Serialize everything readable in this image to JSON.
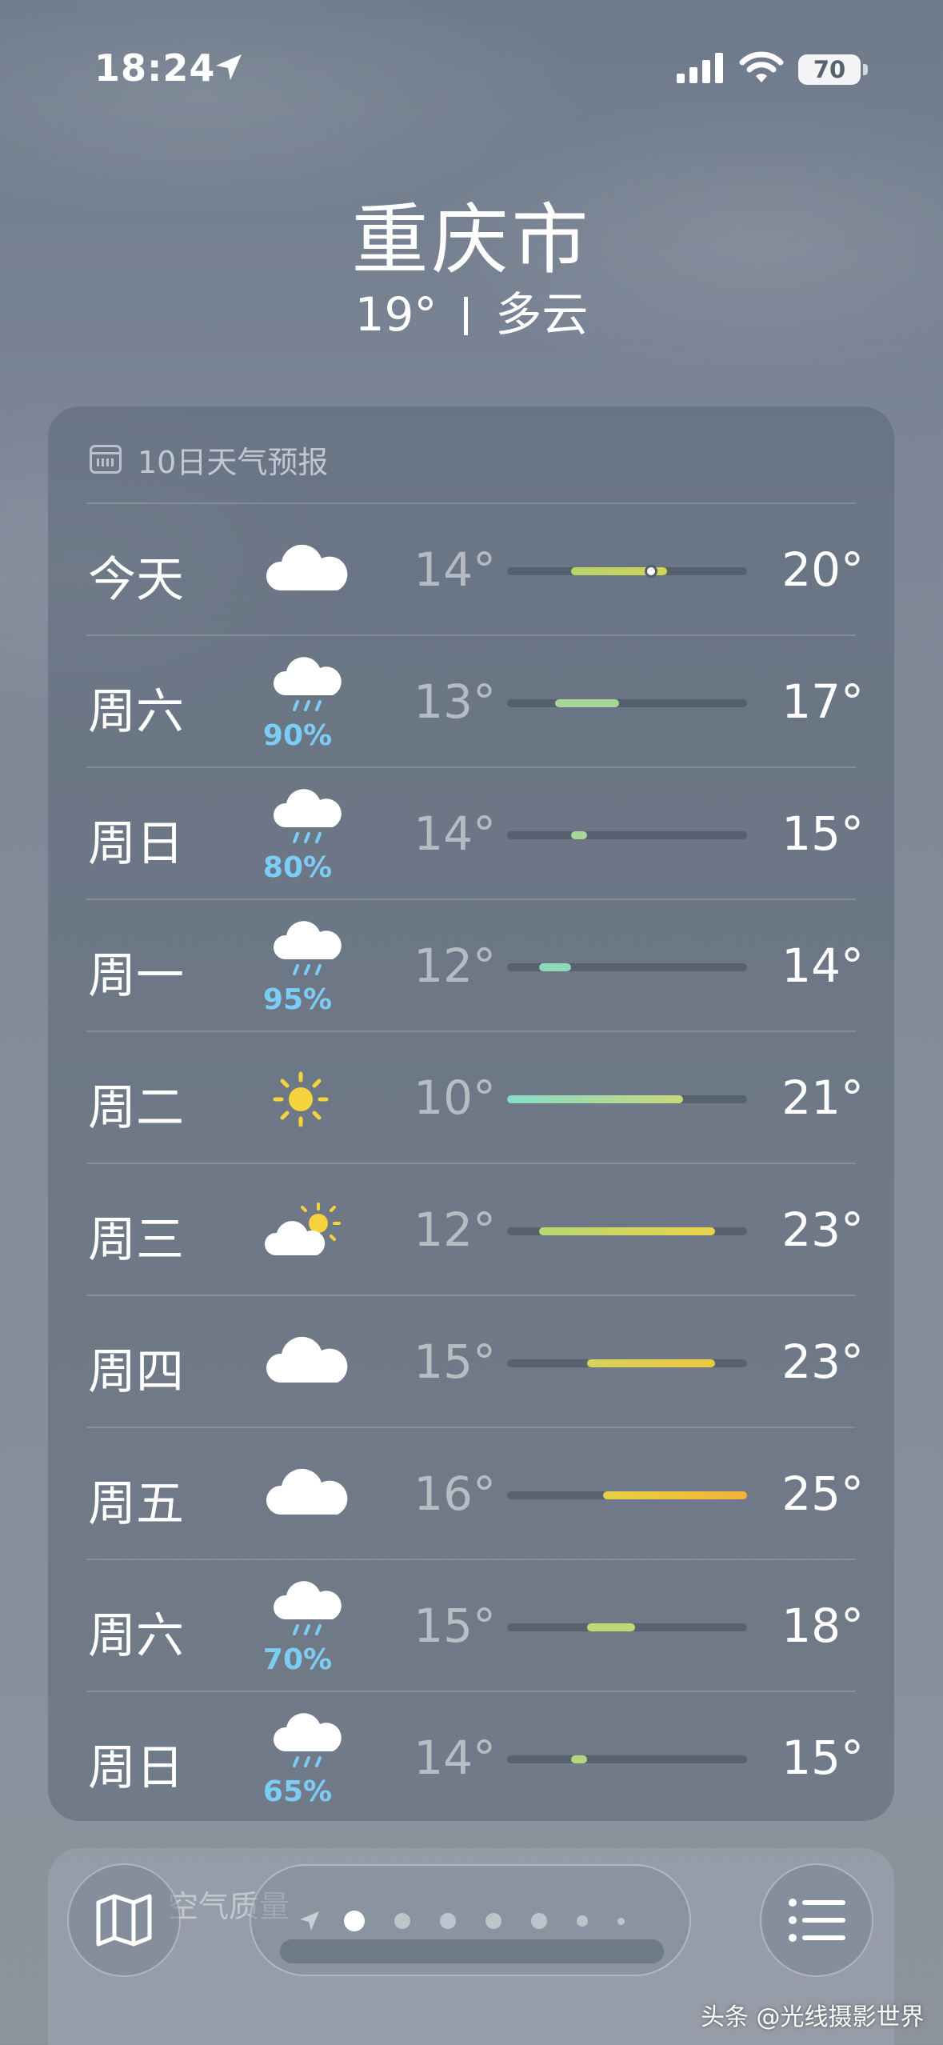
{
  "status_bar": {
    "time": "18:24",
    "battery": "70"
  },
  "header": {
    "city": "重庆市",
    "temp": "19°",
    "condition": "多云"
  },
  "forecast": {
    "title": "10日天气预报",
    "days": [
      {
        "day": "今天",
        "icon": "cloud-icon",
        "pct": "",
        "low": "14°",
        "high": "20°",
        "bar_from": 14,
        "bar_to": 20,
        "current": 19,
        "bar_color": "linear-gradient(90deg,#b6d36a,#d2d457)"
      },
      {
        "day": "周六",
        "icon": "rain-cloud-icon",
        "pct": "90%",
        "low": "13°",
        "high": "17°",
        "bar_from": 13,
        "bar_to": 17,
        "bar_color": "#a8d59a"
      },
      {
        "day": "周日",
        "icon": "rain-cloud-icon",
        "pct": "80%",
        "low": "14°",
        "high": "15°",
        "bar_from": 14,
        "bar_to": 15,
        "bar_color": "#a8d59a"
      },
      {
        "day": "周一",
        "icon": "rain-cloud-icon",
        "pct": "95%",
        "low": "12°",
        "high": "14°",
        "bar_from": 12,
        "bar_to": 14,
        "bar_color": "#8fd8b8"
      },
      {
        "day": "周二",
        "icon": "sun-icon",
        "pct": "",
        "low": "10°",
        "high": "21°",
        "bar_from": 10,
        "bar_to": 21,
        "bar_color": "linear-gradient(90deg,#86dccb,#c9d877)"
      },
      {
        "day": "周三",
        "icon": "partly-sunny-icon",
        "pct": "",
        "low": "12°",
        "high": "23°",
        "bar_from": 12,
        "bar_to": 23,
        "bar_color": "linear-gradient(90deg,#b7d872,#ecd24a)"
      },
      {
        "day": "周四",
        "icon": "cloud-icon",
        "pct": "",
        "low": "15°",
        "high": "23°",
        "bar_from": 15,
        "bar_to": 23,
        "bar_color": "linear-gradient(90deg,#d8d35a,#efc840)"
      },
      {
        "day": "周五",
        "icon": "cloud-icon",
        "pct": "",
        "low": "16°",
        "high": "25°",
        "bar_from": 16,
        "bar_to": 25,
        "bar_color": "linear-gradient(90deg,#e9d045,#f3b238)"
      },
      {
        "day": "周六",
        "icon": "rain-cloud-icon",
        "pct": "70%",
        "low": "15°",
        "high": "18°",
        "bar_from": 15,
        "bar_to": 18,
        "bar_color": "#c2d877"
      },
      {
        "day": "周日",
        "icon": "rain-cloud-icon",
        "pct": "65%",
        "low": "14°",
        "high": "15°",
        "bar_from": 14,
        "bar_to": 15,
        "bar_color": "#b4d67e"
      }
    ]
  },
  "air_quality": {
    "label": "空气质量"
  },
  "pager": {
    "count": 7,
    "active": 0
  },
  "watermark": "头条 @光线摄影世界"
}
